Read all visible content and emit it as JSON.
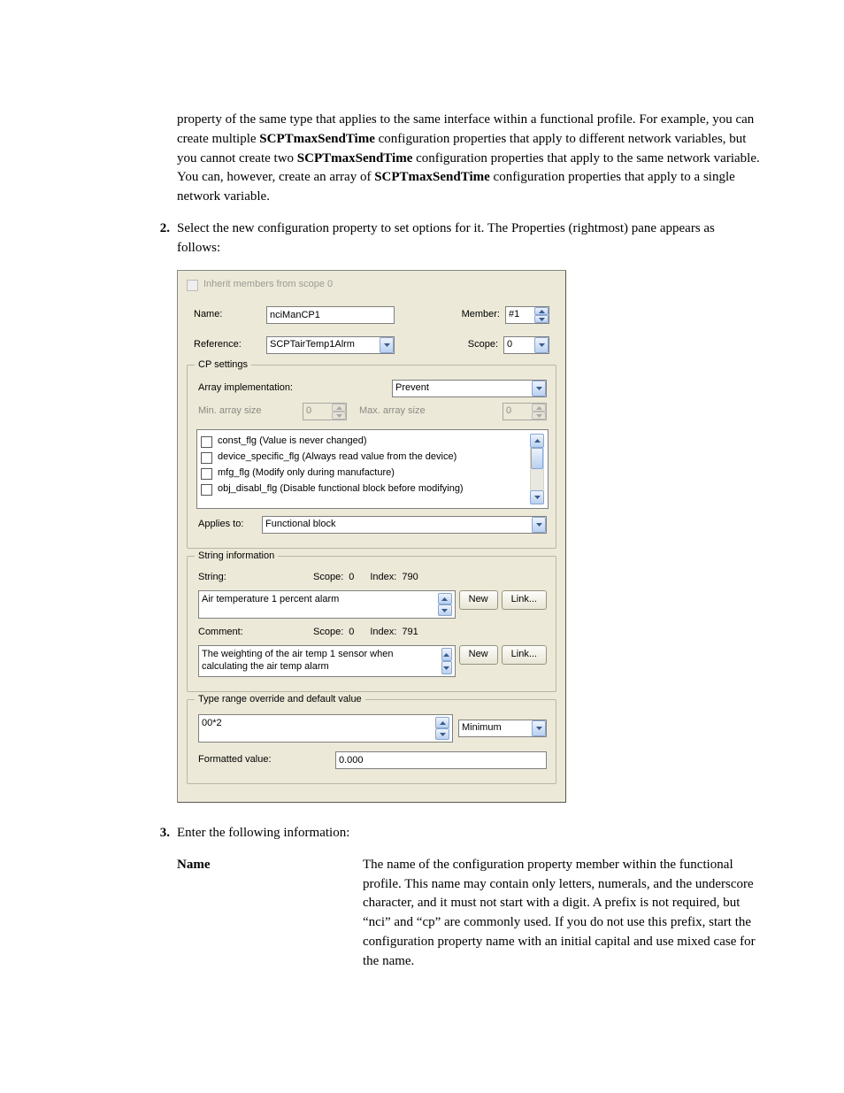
{
  "intro_para": {
    "pre1": "property of the same type that applies to the same interface within a functional profile.  For example, you can create multiple ",
    "b1": "SCPTmaxSendTime",
    "mid1": " configuration properties that apply to different network variables, but you cannot create two ",
    "b2": "SCPTmaxSendTime",
    "mid2": " configuration properties that apply to the same network variable.  You can, however, create an array of ",
    "b3": "SCPTmaxSendTime",
    "post": " configuration properties that apply to a single network variable."
  },
  "step2": {
    "marker": "2.",
    "text": "Select the new configuration property to set options for it.  The Properties (rightmost) pane appears as follows:"
  },
  "step3": {
    "marker": "3.",
    "text": "Enter the following information:"
  },
  "dialog": {
    "inherit_label": "Inherit members from scope 0",
    "name_label": "Name:",
    "name_value": "nciManCP1",
    "member_label": "Member:",
    "member_value": "#1",
    "reference_label": "Reference:",
    "reference_value": "SCPTairTemp1Alrm",
    "scope_label": "Scope:",
    "scope_value": "0",
    "cp_group": "CP settings",
    "array_impl_label": "Array implementation:",
    "array_impl_value": "Prevent",
    "min_array_label": "Min. array size",
    "min_array_value": "0",
    "max_array_label": "Max. array size",
    "max_array_value": "0",
    "flags": [
      "const_flg (Value is never changed)",
      "device_specific_flg (Always read value from the device)",
      "mfg_flg (Modify only during manufacture)",
      "obj_disabl_flg (Disable functional block before modifying)"
    ],
    "applies_to_label": "Applies to:",
    "applies_to_value": "Functional block",
    "string_group": "String information",
    "string_lbl": "String:",
    "string_scope_lbl": "Scope:",
    "string_scope_val": "0",
    "string_index_lbl": "Index:",
    "string_index_val": "790",
    "string_text": "Air temperature 1 percent alarm",
    "comment_lbl": "Comment:",
    "comment_scope_lbl": "Scope:",
    "comment_scope_val": "0",
    "comment_index_lbl": "Index:",
    "comment_index_val": "791",
    "comment_text": "The weighting of the air temp 1 sensor when calculating the air temp alarm",
    "btn_new": "New",
    "btn_link": "Link...",
    "override_group": "Type range override and default value",
    "override_hex": "00*2",
    "override_select": "Minimum",
    "formatted_lbl": "Formatted value:",
    "formatted_val": "0.000"
  },
  "def": {
    "term": "Name",
    "body": "The name of the configuration property member within the functional profile.  This name may contain only letters, numerals, and the underscore character, and it must not start with a digit.  A prefix is not required, but “nci” and “cp” are commonly used.  If you do not use this prefix, start the configuration property name with an initial capital and use mixed case for the name."
  }
}
